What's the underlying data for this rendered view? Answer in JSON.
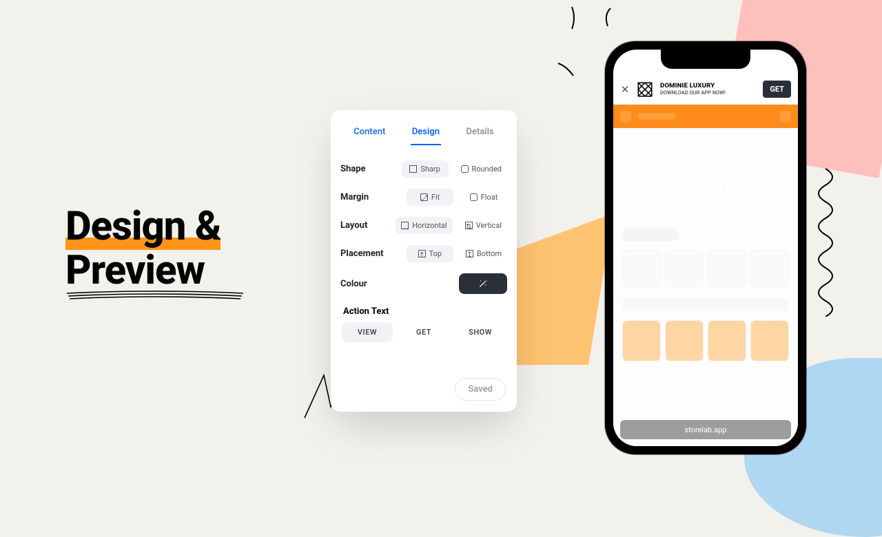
{
  "hero": {
    "line1": "Design &",
    "line2": "Preview"
  },
  "panel": {
    "tabs": {
      "content": "Content",
      "design": "Design",
      "details": "Details"
    },
    "rows": {
      "shape": {
        "label": "Shape",
        "a": "Sharp",
        "b": "Rounded"
      },
      "margin": {
        "label": "Margin",
        "a": "Fit",
        "b": "Float"
      },
      "layout": {
        "label": "Layout",
        "a": "Horizontal",
        "b": "Vertical"
      },
      "placement": {
        "label": "Placement",
        "a": "Top",
        "b": "Bottom"
      },
      "colour": {
        "label": "Colour"
      }
    },
    "action": {
      "label": "Action Text",
      "options": {
        "view": "VIEW",
        "get": "GET",
        "show": "SHOW"
      }
    },
    "saved": "Saved",
    "colour_value": "#2a3038"
  },
  "phone": {
    "banner": {
      "title": "DOMINIE LUXURY",
      "subtitle": "DOWNLOAD OUR APP NOW!",
      "cta": "GET",
      "close": "✕"
    },
    "ghost_text": "This is your website",
    "address": "storelab.app",
    "accent": "#fe8b1b"
  }
}
